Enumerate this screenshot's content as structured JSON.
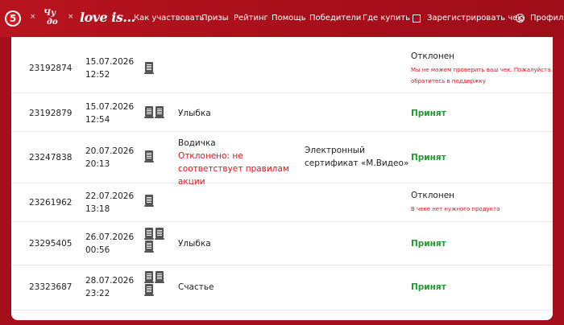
{
  "header": {
    "logo_text": "5",
    "separator": "×",
    "chudo_letters": [
      "Чу",
      "до"
    ],
    "loveis_text": "love is...",
    "nav": [
      "Как участвовать",
      "Призы",
      "Рейтинг",
      "Помощь",
      "Победители",
      "Где купить"
    ],
    "register_label": "Зарегистрировать чек",
    "profile_label": "Профиль"
  },
  "rows": [
    {
      "id": "23192874",
      "date": "15.07.2026",
      "time": "12:52",
      "receipts": 1,
      "prize": "",
      "prize_note": "",
      "cert": "",
      "status": "Отклонен",
      "status_note": "Мы не можем проверить ваш чек. Пожалуйста обратитесь в поддержку"
    },
    {
      "id": "23192879",
      "date": "15.07.2026",
      "time": "12:54",
      "receipts": 2,
      "prize": "Улыбка",
      "prize_note": "",
      "cert": "",
      "status": "Принят",
      "status_note": ""
    },
    {
      "id": "23247838",
      "date": "20.07.2026",
      "time": "20:13",
      "receipts": 1,
      "prize": "Водичка",
      "prize_note": "Отклонено: не соответствует правилам акции",
      "cert": "Электронный сертификат «М.Видео»",
      "status": "Принят",
      "status_note": ""
    },
    {
      "id": "23261962",
      "date": "22.07.2026",
      "time": "13:18",
      "receipts": 1,
      "prize": "",
      "prize_note": "",
      "cert": "",
      "status": "Отклонен",
      "status_note": "В чеке нет нужного продукта"
    },
    {
      "id": "23295405",
      "date": "26.07.2026",
      "time": "00:56",
      "receipts": 3,
      "prize": "Улыбка",
      "prize_note": "",
      "cert": "",
      "status": "Принят",
      "status_note": ""
    },
    {
      "id": "23323687",
      "date": "28.07.2026",
      "time": "23:22",
      "receipts": 3,
      "prize": "Счастье",
      "prize_note": "",
      "cert": "",
      "status": "Принят",
      "status_note": ""
    }
  ]
}
